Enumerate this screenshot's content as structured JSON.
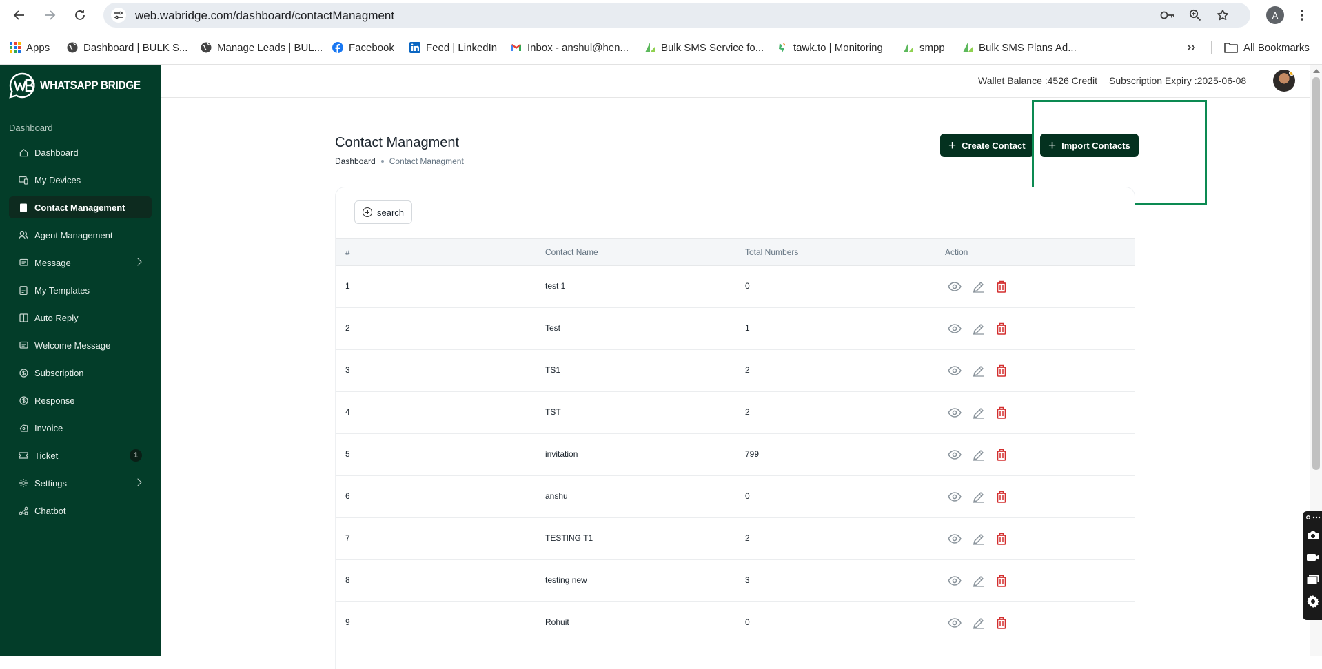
{
  "browser": {
    "url": "web.wabridge.com/dashboard/contactManagment",
    "profile_initial": "A",
    "bookmarks": [
      {
        "label": "Apps",
        "icon": "apps-grid-icon"
      },
      {
        "label": "Dashboard | BULK S...",
        "icon": "globe-icon"
      },
      {
        "label": "Manage Leads | BUL...",
        "icon": "globe-icon"
      },
      {
        "label": "Facebook",
        "icon": "facebook-icon"
      },
      {
        "label": "Feed | LinkedIn",
        "icon": "linkedin-icon"
      },
      {
        "label": "Inbox - anshul@hen...",
        "icon": "gmail-icon"
      },
      {
        "label": "Bulk SMS Service fo...",
        "icon": "bulksms-icon"
      },
      {
        "label": "tawk.to | Monitoring",
        "icon": "tawkto-icon"
      },
      {
        "label": "smpp",
        "icon": "bulksms-icon"
      },
      {
        "label": "Bulk SMS Plans Ad...",
        "icon": "bulksms-icon"
      }
    ],
    "all_bookmarks": "All Bookmarks"
  },
  "brand": {
    "name": "WHATSAPP BRIDGE",
    "accent": "#033d29",
    "button_color": "#04311f",
    "highlight_color": "#0c8a52",
    "danger_color": "#d32f2f"
  },
  "sidebar": {
    "section": "Dashboard",
    "items": [
      {
        "label": "Dashboard",
        "icon": "home-icon"
      },
      {
        "label": "My Devices",
        "icon": "devices-icon"
      },
      {
        "label": "Contact Management",
        "icon": "contact-book-icon",
        "active": true
      },
      {
        "label": "Agent Management",
        "icon": "agents-icon"
      },
      {
        "label": "Message",
        "icon": "message-icon",
        "has_submenu": true
      },
      {
        "label": "My Templates",
        "icon": "template-icon"
      },
      {
        "label": "Auto Reply",
        "icon": "auto-reply-icon"
      },
      {
        "label": "Welcome Message",
        "icon": "welcome-icon"
      },
      {
        "label": "Subscription",
        "icon": "dollar-icon"
      },
      {
        "label": "Response",
        "icon": "dollar-icon"
      },
      {
        "label": "Invoice",
        "icon": "invoice-icon"
      },
      {
        "label": "Ticket",
        "icon": "ticket-icon",
        "badge": "1"
      },
      {
        "label": "Settings",
        "icon": "gear-icon",
        "has_submenu": true
      },
      {
        "label": "Chatbot",
        "icon": "chatbot-icon"
      }
    ]
  },
  "header": {
    "wallet_label": "Wallet Balance :",
    "wallet_value": "4526 Credit",
    "expiry_label": "Subscription Expiry :",
    "expiry_value": "2025-06-08"
  },
  "page": {
    "title": "Contact Managment",
    "breadcrumb_home": "Dashboard",
    "breadcrumb_current": "Contact Managment",
    "create_button": "Create Contact",
    "import_button": "Import Contacts",
    "search_button": "search"
  },
  "table": {
    "columns": [
      "#",
      "Contact Name",
      "Total Numbers",
      "Action"
    ],
    "rows": [
      {
        "id": "1",
        "name": "test 1",
        "total": "0"
      },
      {
        "id": "2",
        "name": "Test",
        "total": "1"
      },
      {
        "id": "3",
        "name": "TS1",
        "total": "2"
      },
      {
        "id": "4",
        "name": "TST",
        "total": "2"
      },
      {
        "id": "5",
        "name": "invitation",
        "total": "799"
      },
      {
        "id": "6",
        "name": "anshu",
        "total": "0"
      },
      {
        "id": "7",
        "name": "TESTING T1",
        "total": "2"
      },
      {
        "id": "8",
        "name": "testing new",
        "total": "3"
      },
      {
        "id": "9",
        "name": "Rohuit",
        "total": "0"
      }
    ],
    "row_actions": [
      "view-eye-icon",
      "edit-pencil-icon",
      "delete-trash-icon"
    ]
  }
}
